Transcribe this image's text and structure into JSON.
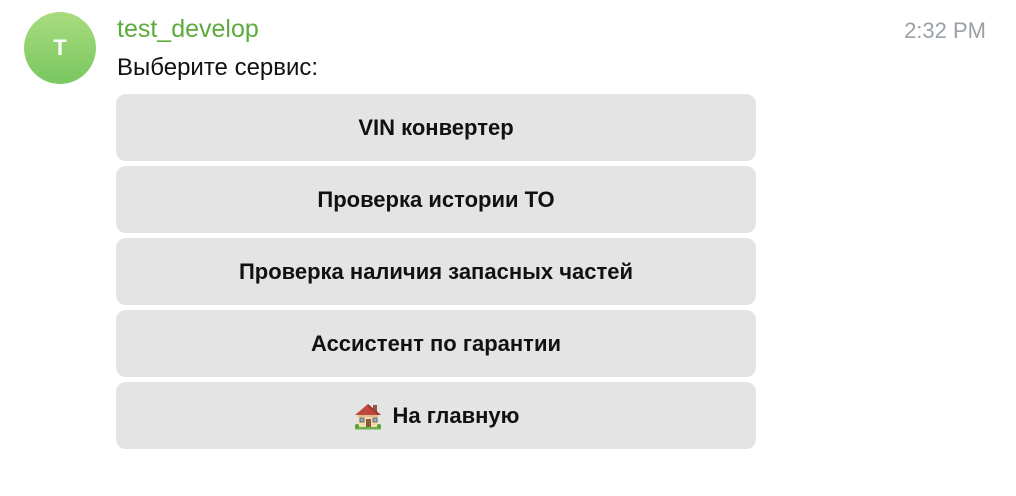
{
  "message": {
    "avatar_letter": "T",
    "sender": "test_develop",
    "time": "2:32 PM",
    "text": "Выберите сервис:"
  },
  "keyboard": {
    "buttons": [
      {
        "label": "VIN конвертер"
      },
      {
        "label": "Проверка истории ТО"
      },
      {
        "label": "Проверка наличия запасных частей"
      },
      {
        "label": "Ассистент по гарантии"
      },
      {
        "label": "На главную",
        "icon": "house-icon"
      }
    ]
  },
  "colors": {
    "sender": "#5dab3c",
    "avatar_gradient_top": "#a8dc7e",
    "avatar_gradient_bottom": "#79c760",
    "button_bg": "#e4e4e4",
    "time": "#9aa0a6"
  }
}
